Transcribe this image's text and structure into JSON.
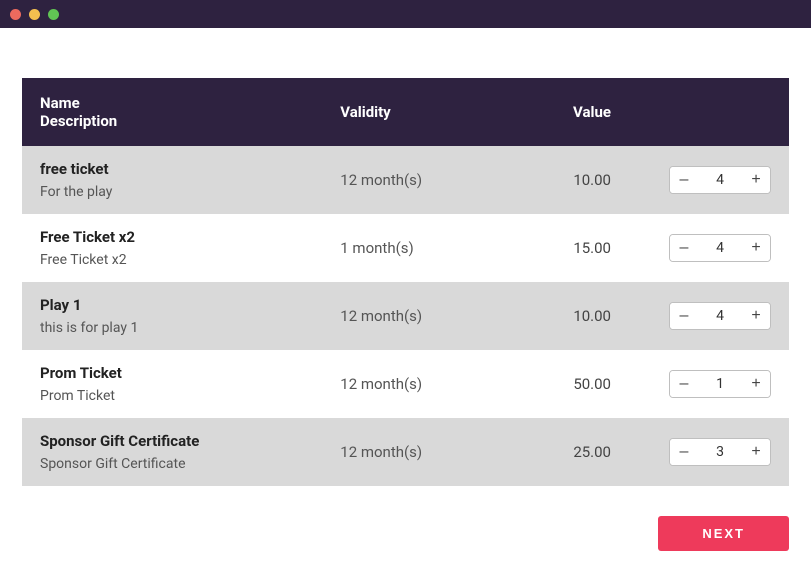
{
  "columns": {
    "name_label": "Name",
    "description_label": "Description",
    "validity_label": "Validity",
    "value_label": "Value"
  },
  "rows": [
    {
      "name": "free ticket",
      "description": "For the play",
      "validity": "12 month(s)",
      "value": "10.00",
      "qty": "4"
    },
    {
      "name": "Free Ticket x2",
      "description": "Free Ticket x2",
      "validity": "1 month(s)",
      "value": "15.00",
      "qty": "4"
    },
    {
      "name": "Play 1",
      "description": "this is for play 1",
      "validity": "12 month(s)",
      "value": "10.00",
      "qty": "4"
    },
    {
      "name": "Prom Ticket",
      "description": "Prom Ticket",
      "validity": "12 month(s)",
      "value": "50.00",
      "qty": "1"
    },
    {
      "name": "Sponsor Gift Certificate",
      "description": "Sponsor Gift Certificate",
      "validity": "12 month(s)",
      "value": "25.00",
      "qty": "3"
    }
  ],
  "buttons": {
    "next": "NEXT",
    "minus": "–",
    "plus": "+"
  }
}
